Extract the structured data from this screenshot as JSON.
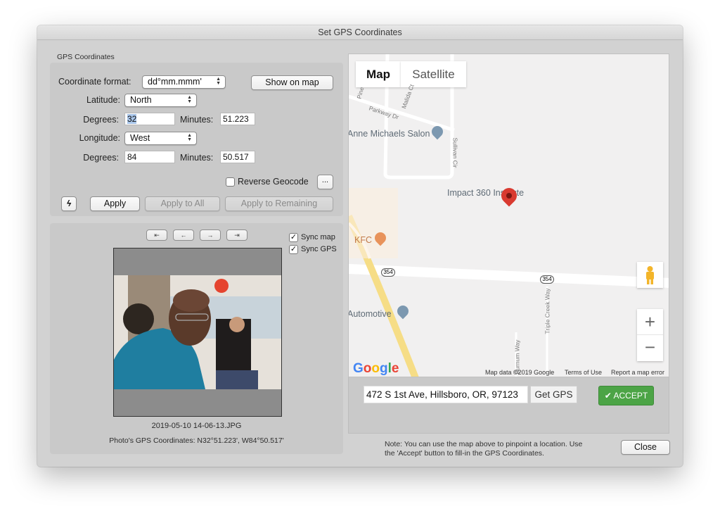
{
  "window": {
    "title": "Set GPS Coordinates"
  },
  "gps_section": {
    "label": "GPS Coordinates",
    "coordinate_format_label": "Coordinate format:",
    "coordinate_format_value": "dd°mm.mmm'",
    "show_on_map_label": "Show on map",
    "latitude_label": "Latitude:",
    "latitude_value": "North",
    "lat_degrees_label": "Degrees:",
    "lat_degrees_value": "32",
    "lat_minutes_label": "Minutes:",
    "lat_minutes_value": "51.223",
    "longitude_label": "Longitude:",
    "longitude_value": "West",
    "lon_degrees_label": "Degrees:",
    "lon_degrees_value": "84",
    "lon_minutes_label": "Minutes:",
    "lon_minutes_value": "50.517",
    "reverse_geocode_label": "Reverse Geocode",
    "reverse_geocode_checked": false,
    "more_button_label": "...",
    "quick_button_icon": "lightning-icon",
    "apply_label": "Apply",
    "apply_all_label": "Apply to All",
    "apply_remaining_label": "Apply to Remaining"
  },
  "photo_section": {
    "nav_buttons": [
      {
        "icon": "first-icon",
        "glyph": "⇤"
      },
      {
        "icon": "previous-icon",
        "glyph": "←"
      },
      {
        "icon": "next-icon",
        "glyph": "→"
      },
      {
        "icon": "last-icon",
        "glyph": "⇥"
      }
    ],
    "sync_map_label": "Sync map",
    "sync_map_checked": true,
    "sync_gps_label": "Sync GPS",
    "sync_gps_checked": true,
    "filename": "2019-05-10 14-06-13.JPG",
    "gps_readout": "Photo's GPS Coordinates: N32°51.223', W84°50.517'"
  },
  "map": {
    "tabs": [
      {
        "label": "Map",
        "active": true
      },
      {
        "label": "Satellite",
        "active": false
      }
    ],
    "places": [
      {
        "name": "Anne Michaels Salon"
      },
      {
        "name": "Impact 360 Institute"
      },
      {
        "name": "KFC"
      },
      {
        "name": "Automotive"
      }
    ],
    "streets": [
      "Pine",
      "Malida Ct",
      "Parkway Dr",
      "Sullivan Cir",
      "Triple Creek Way",
      "Burnum Way"
    ],
    "route_shield": "354",
    "google_logo": "Google",
    "attribution": "Map data ©2019 Google",
    "terms": "Terms of Use",
    "report": "Report a map error",
    "zoom_in": "+",
    "zoom_out": "−",
    "marker_color": "#d93a30"
  },
  "address": {
    "value": "472 S 1st Ave, Hillsboro, OR, 97123",
    "get_gps_label": "Get GPS",
    "accept_label": "ACCEPT",
    "accept_color": "#4ca446"
  },
  "note": {
    "line1": "Note: You can use the map above to pinpoint a location.  Use",
    "line2": "the 'Accept' button to fill-in the GPS Coordinates."
  },
  "close_label": "Close"
}
